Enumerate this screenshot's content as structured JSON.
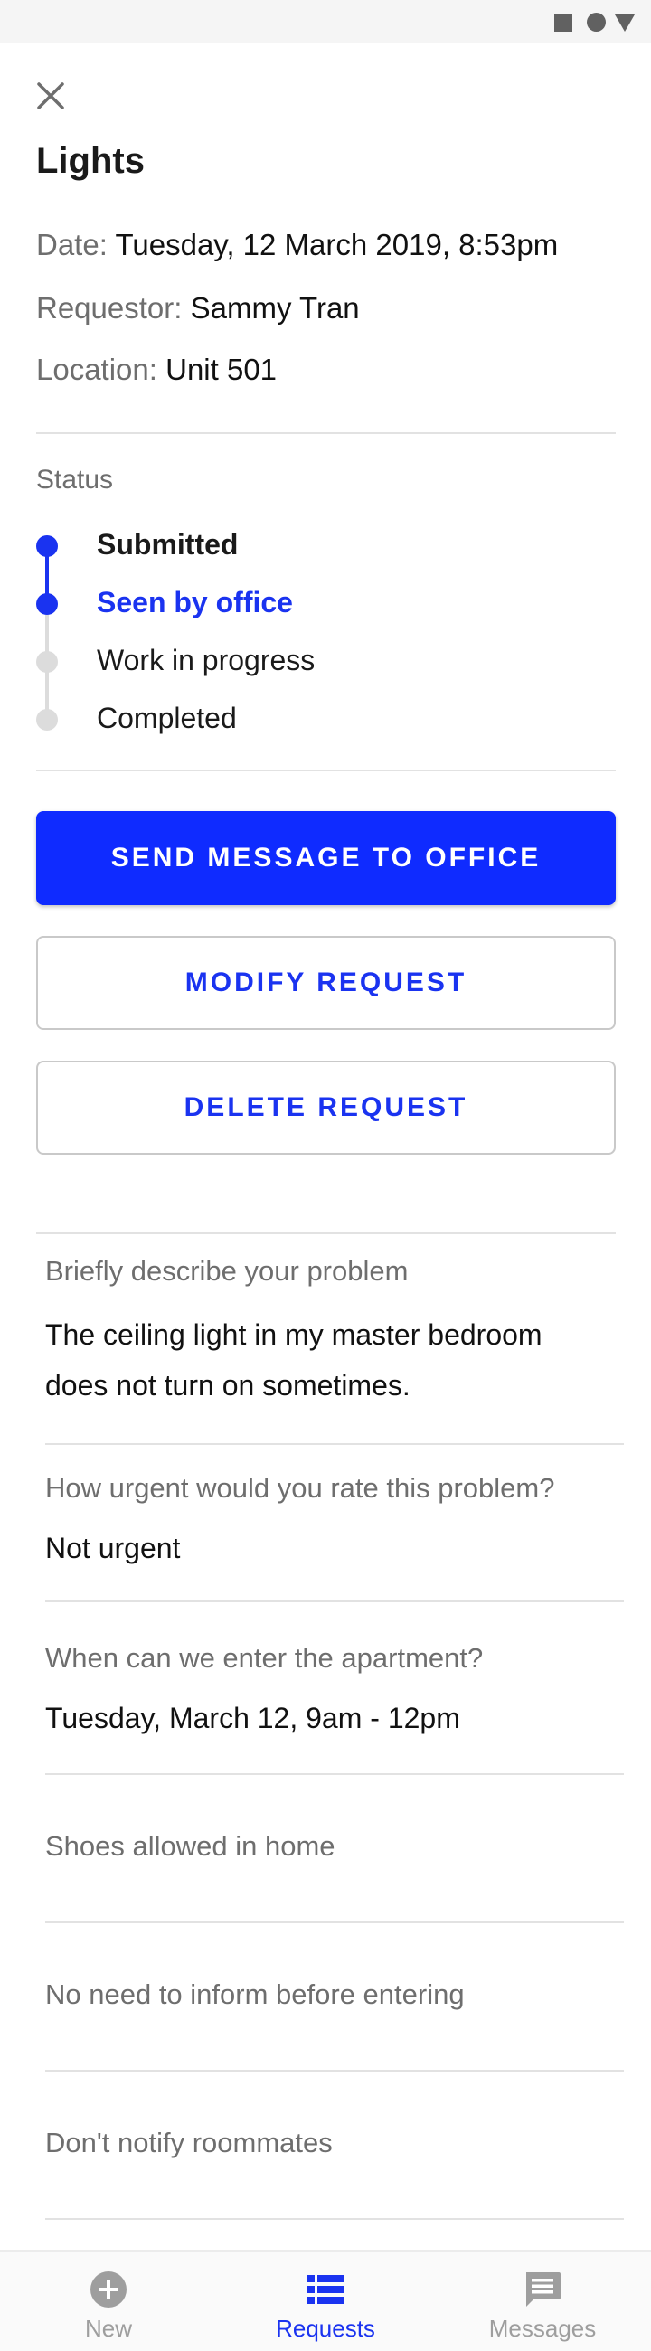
{
  "header": {
    "title": "Lights"
  },
  "details": {
    "date_label": "Date:",
    "date_value": "Tuesday, 12 March 2019, 8:53pm",
    "requestor_label": "Requestor:",
    "requestor_value": "Sammy Tran",
    "location_label": "Location:",
    "location_value": "Unit 501"
  },
  "status": {
    "label": "Status",
    "steps": [
      {
        "label": "Submitted",
        "state": "done"
      },
      {
        "label": "Seen by office",
        "state": "current"
      },
      {
        "label": "Work in progress",
        "state": "pending"
      },
      {
        "label": "Completed",
        "state": "pending"
      }
    ]
  },
  "actions": {
    "send_message": "SEND MESSAGE TO OFFICE",
    "modify": "MODIFY REQUEST",
    "delete": "DELETE REQUEST"
  },
  "fields": {
    "problem_label": "Briefly describe your problem",
    "problem_line1": "The ceiling light in my master bedroom",
    "problem_line2": "does not turn on sometimes.",
    "urgency_label": "How urgent would you rate this problem?",
    "urgency_value": "Not urgent",
    "entry_label": "When can we enter the apartment?",
    "entry_value": "Tuesday, March 12, 9am - 12pm",
    "shoes": "Shoes allowed in home",
    "inform": "No need to inform before entering",
    "roommates": "Don't notify roommates"
  },
  "nav": {
    "items": [
      {
        "label": "New",
        "icon": "add-circle-icon",
        "active": false
      },
      {
        "label": "Requests",
        "icon": "list-icon",
        "active": true
      },
      {
        "label": "Messages",
        "icon": "message-icon",
        "active": false
      }
    ]
  },
  "colors": {
    "accent": "#1a33f0",
    "primary_button": "#0f2bff",
    "inactive": "#9e9e9e",
    "pending_dot": "#dcdcdc"
  }
}
